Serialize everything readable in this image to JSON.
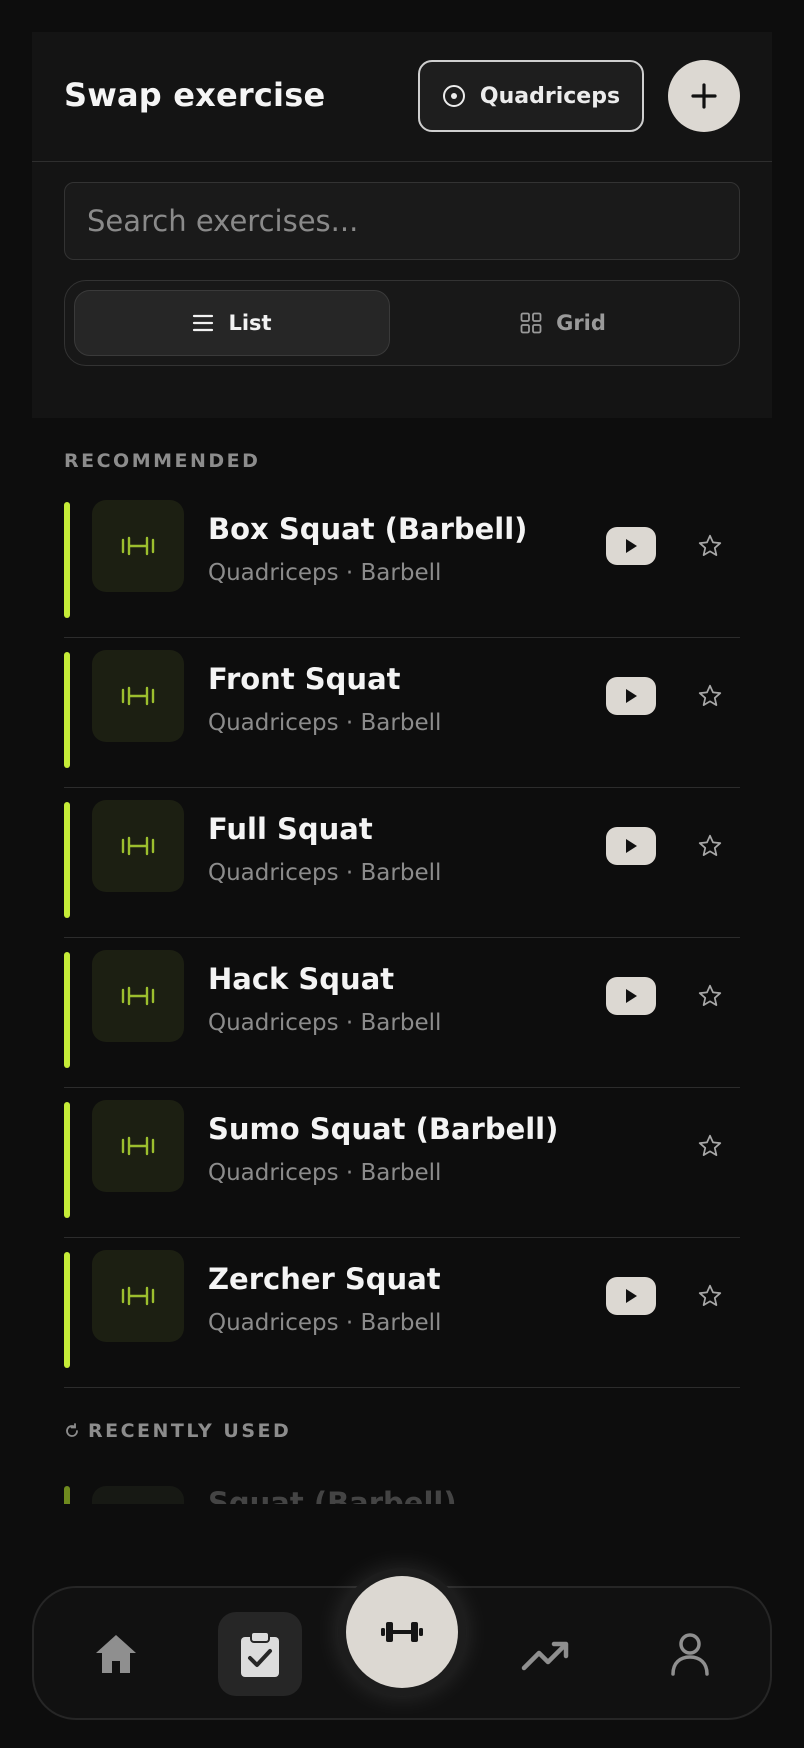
{
  "header": {
    "title": "Swap exercise",
    "muscle_filter": "Quadriceps",
    "add_icon": "plus-icon"
  },
  "search": {
    "placeholder": "Search exercises..."
  },
  "view_toggle": {
    "list_label": "List",
    "grid_label": "Grid",
    "selected": "List"
  },
  "sections": {
    "recommended": "RECOMMENDED",
    "recent": "RECENTLY USED",
    "recent_icon": "history-icon"
  },
  "exercises": [
    {
      "name": "Box Squat (Barbell)",
      "meta": "Quadriceps · Barbell",
      "has_video": true
    },
    {
      "name": "Front Squat",
      "meta": "Quadriceps · Barbell",
      "has_video": true
    },
    {
      "name": "Full Squat",
      "meta": "Quadriceps · Barbell",
      "has_video": true
    },
    {
      "name": "Hack Squat",
      "meta": "Quadriceps · Barbell",
      "has_video": true
    },
    {
      "name": "Sumo Squat (Barbell)",
      "meta": "Quadriceps · Barbell",
      "has_video": false
    },
    {
      "name": "Zercher Squat",
      "meta": "Quadriceps · Barbell",
      "has_video": true
    }
  ],
  "recent_partial": {
    "name": "Squat (Barbell)"
  },
  "nav": {
    "items": [
      "home-icon",
      "clipboard-check-icon",
      "dumbbell-icon",
      "trending-up-icon",
      "user-icon"
    ],
    "active": "dumbbell-icon"
  },
  "colors": {
    "accent": "#c5ec38",
    "background": "#0d0d0d",
    "panel": "#141414",
    "button_light": "#dcd8d2"
  }
}
